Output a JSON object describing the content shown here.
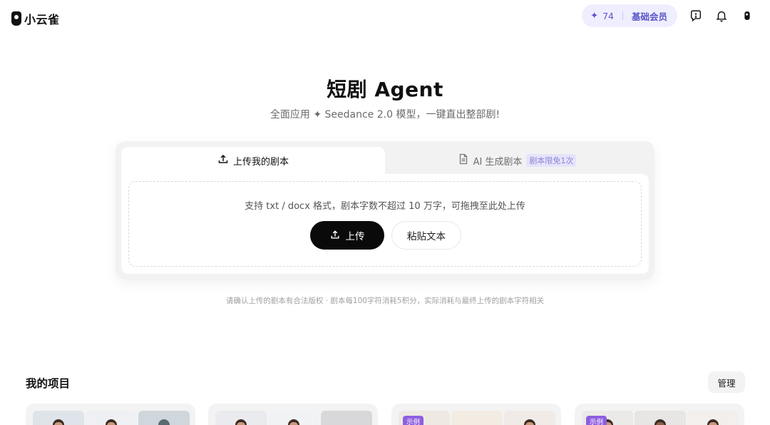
{
  "header": {
    "logo_text": "小云雀",
    "credits": "74",
    "membership": "基础会员",
    "icons": [
      "sparkle-icon",
      "feedback-icon",
      "bell-icon",
      "profile-icon"
    ]
  },
  "hero": {
    "title": "短剧 Agent",
    "subtitle": "全面应用 ✦ Seedance 2.0 模型，一键直出整部剧!"
  },
  "upload_card": {
    "tabs": [
      {
        "label": "上传我的剧本",
        "icon": "upload-icon",
        "active": true
      },
      {
        "label": "AI 生成剧本",
        "icon": "document-icon",
        "badge": "剧本限免1次",
        "active": false
      }
    ],
    "hint": "支持 txt / docx 格式，剧本字数不超过 10 万字，可拖拽至此处上传",
    "upload_label": "上传",
    "paste_label": "粘贴文本"
  },
  "disclaimer": "请确认上传的剧本有合法版权 · 剧本每100字符消耗5积分，实际消耗与最终上传的剧本字符相关",
  "projects": {
    "title": "我的项目",
    "manage_label": "管理",
    "cards": [
      {
        "badge": ""
      },
      {
        "badge": ""
      },
      {
        "badge": "示例"
      },
      {
        "badge": "示例"
      }
    ]
  },
  "colors": {
    "accent": "#5b55c8",
    "pill_bg": "#efeefe",
    "primary_button": "#0a0a0a",
    "sample_badge": "#8e5ee0"
  }
}
